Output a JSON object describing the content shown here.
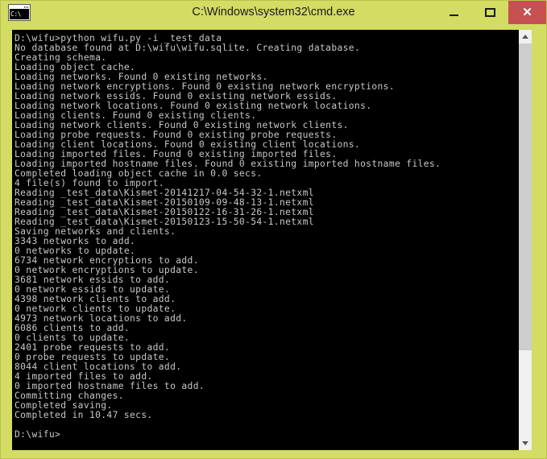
{
  "window": {
    "title": "C:\\Windows\\system32\\cmd.exe",
    "icon_name": "cmd-window-icon",
    "icon_text": "C:\\",
    "chrome_color": "#d3dc63",
    "close_button_color": "#c75050",
    "console_background": "#000000",
    "console_text_color": "#c8c8c8"
  },
  "controls": {
    "minimize_label": "",
    "maximize_label": "",
    "close_label": "✕"
  },
  "console": {
    "lines": [
      "D:\\wifu>python wifu.py -i _test_data",
      "No database found at D:\\wifu\\wifu.sqlite. Creating database.",
      "Creating schema.",
      "Loading object cache.",
      "Loading networks. Found 0 existing networks.",
      "Loading network encryptions. Found 0 existing network encryptions.",
      "Loading network essids. Found 0 existing network essids.",
      "Loading network locations. Found 0 existing network locations.",
      "Loading clients. Found 0 existing clients.",
      "Loading network clients. Found 0 existing network clients.",
      "Loading probe requests. Found 0 existing probe requests.",
      "Loading client locations. Found 0 existing client locations.",
      "Loading imported files. Found 0 existing imported files.",
      "Loading imported hostname files. Found 0 existing imported hostname files.",
      "Completed loading object cache in 0.0 secs.",
      "4 file(s) found to import.",
      "Reading _test_data\\Kismet-20141217-04-54-32-1.netxml",
      "Reading _test_data\\Kismet-20150109-09-48-13-1.netxml",
      "Reading _test_data\\Kismet-20150122-16-31-26-1.netxml",
      "Reading _test_data\\Kismet-20150123-15-50-54-1.netxml",
      "Saving networks and clients.",
      "3343 networks to add.",
      "0 networks to update.",
      "6734 network encryptions to add.",
      "0 network encryptions to update.",
      "3681 network essids to add.",
      "0 network essids to update.",
      "4398 network clients to add.",
      "0 network clients to update.",
      "4973 network locations to add.",
      "6086 clients to add.",
      "0 clients to update.",
      "2401 probe requests to add.",
      "0 probe requests to update.",
      "8044 client locations to add.",
      "4 imported files to add.",
      "0 imported hostname files to add.",
      "Committing changes.",
      "Completed saving.",
      "Completed in 10.47 secs.",
      "",
      "D:\\wifu>"
    ]
  },
  "scrollbar": {
    "up_arrow": "scroll-up",
    "down_arrow": "scroll-down"
  }
}
